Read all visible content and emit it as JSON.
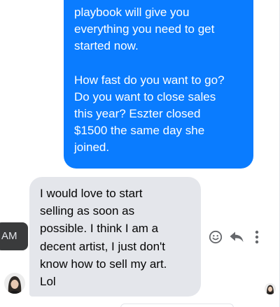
{
  "conversation": {
    "outgoing_message": {
      "paragraph_1": "playbook will give you\neverything you need to get\nstarted now.",
      "paragraph_2": "How fast do you want to go?\nDo you want to close sales\nthis year?  Eszter closed\n$1500 the same day she\njoined.",
      "bubble_color": "#0a7cff"
    },
    "incoming_message": {
      "text": "I would love to start\nselling as soon as\npossible.  I think I am a\ndecent artist, I just don't\nknow how to sell my art.\nLol",
      "bubble_color": "#e4e6eb"
    },
    "timestamp_tooltip": "AM",
    "message_actions": [
      {
        "icon": "smiley-icon",
        "action": "react"
      },
      {
        "icon": "reply-icon",
        "action": "reply"
      },
      {
        "icon": "more-icon",
        "action": "more"
      }
    ],
    "sender_avatar_icon": "avatar",
    "read_receipt_icon": "read-receipt-avatar"
  }
}
